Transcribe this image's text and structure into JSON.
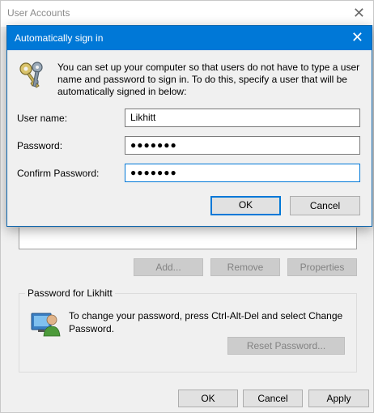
{
  "background_window": {
    "title": "User Accounts",
    "close_glyph": "✕",
    "buttons": {
      "add": "Add...",
      "remove": "Remove",
      "properties": "Properties"
    },
    "password_group": {
      "label": "Password for Likhitt",
      "text": "To change your password, press Ctrl-Alt-Del and select Change Password.",
      "reset_button": "Reset Password...",
      "icon": "user-password-icon"
    },
    "footer": {
      "ok": "OK",
      "cancel": "Cancel",
      "apply": "Apply"
    }
  },
  "dialog": {
    "title": "Automatically sign in",
    "close_glyph": "✕",
    "icon": "keys-icon",
    "description": "You can set up your computer so that users do not have to type a user name and password to sign in. To do this, specify a user that will be automatically signed in below:",
    "fields": {
      "username": {
        "label": "User name:",
        "value": "Likhitt"
      },
      "password": {
        "label": "Password:",
        "value": "●●●●●●●"
      },
      "confirm": {
        "label": "Confirm Password:",
        "value": "●●●●●●●"
      }
    },
    "ok": "OK",
    "cancel": "Cancel"
  },
  "colors": {
    "accent": "#0078d7",
    "window_bg": "#f0f0f0"
  }
}
